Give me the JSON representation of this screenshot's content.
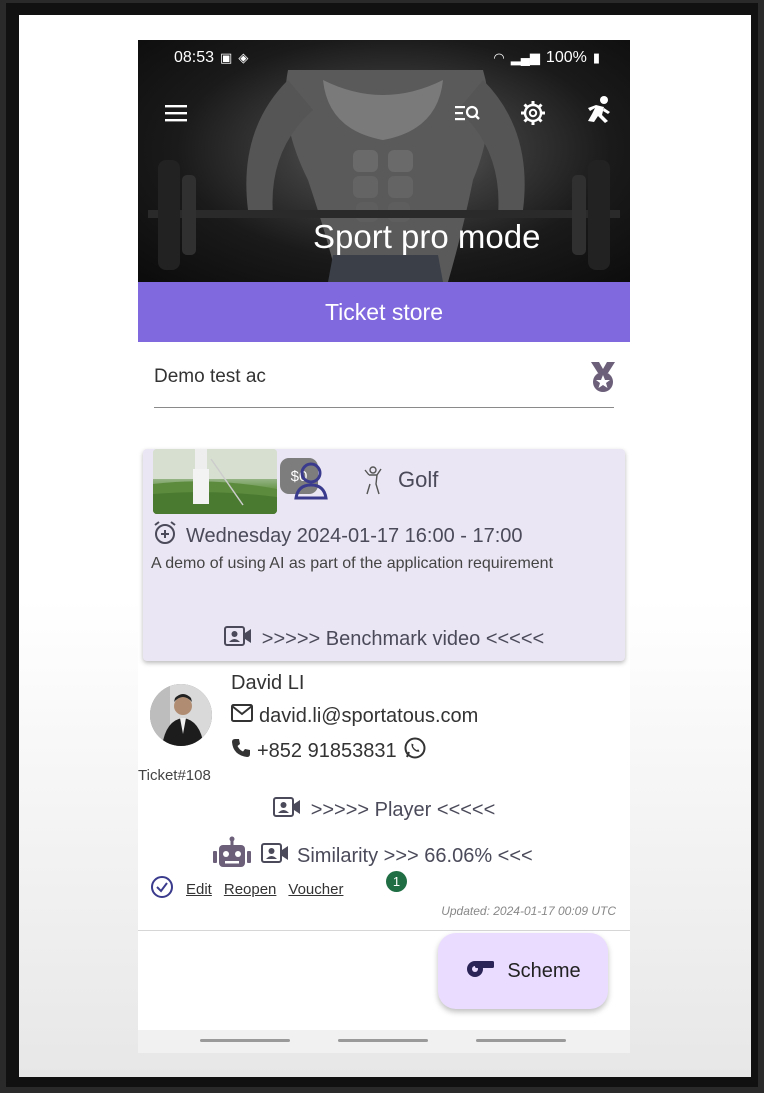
{
  "status_bar": {
    "time": "08:53",
    "battery": "100%"
  },
  "hero": {
    "title": "Sport pro mode"
  },
  "icons": {
    "menu": "menu-icon",
    "search": "search-list-icon",
    "settings": "gear-icon",
    "run": "running-person-icon",
    "medal": "medal-icon"
  },
  "page": {
    "title": "Ticket store"
  },
  "account": {
    "value": "Demo test ac"
  },
  "event": {
    "price": "$0",
    "sport": "Golf",
    "time": "Wednesday 2024-01-17 16:00 - 17:00",
    "description": "A demo of using AI as part of the application requirement",
    "benchmark_link": ">>>>> Benchmark video <<<<<"
  },
  "player": {
    "name": "David LI",
    "email": "david.li@sportatous.com",
    "phone": "+852 91853831",
    "ticket": "Ticket#108",
    "player_link": ">>>>> Player <<<<<",
    "similarity_link": "Similarity >>> 66.06% <<<"
  },
  "actions": {
    "edit": "Edit",
    "reopen": "Reopen",
    "voucher": "Voucher",
    "voucher_badge": "1"
  },
  "updated": "Updated: 2024-01-17 00:09 UTC",
  "fab": {
    "label": "Scheme"
  },
  "colors": {
    "accent": "#8069de",
    "card": "#ebe6f3",
    "fab": "#eadcff",
    "badge": "#1f6e44"
  }
}
